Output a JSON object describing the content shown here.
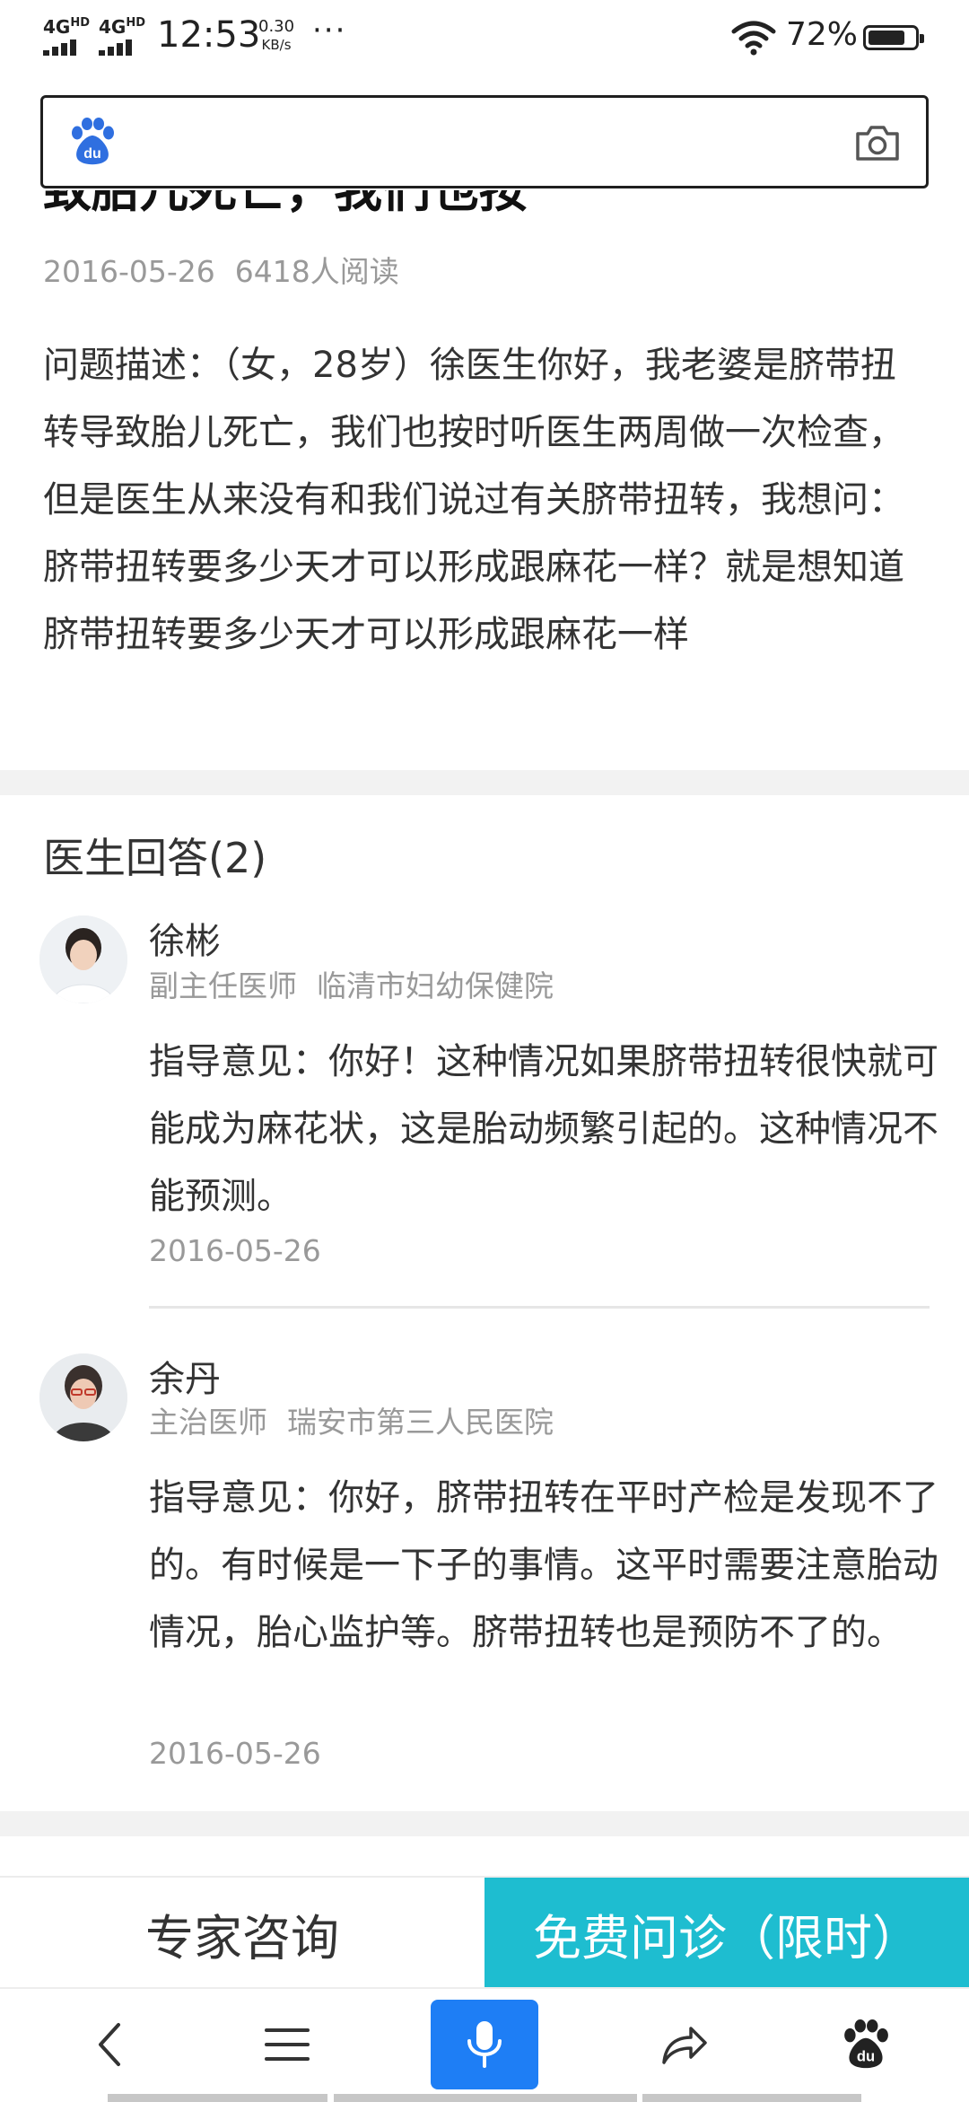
{
  "status_bar": {
    "network1": "4G",
    "network1_sup": "HD",
    "network2": "4G",
    "network2_sup": "HD",
    "time": "12:53",
    "speed_value": "0.30",
    "speed_unit": "KB/s",
    "more": "···",
    "battery_percent": "72%"
  },
  "search": {
    "logo_text": "du",
    "logo_icon": "baidu-paw-icon",
    "camera_icon": "camera-icon"
  },
  "article": {
    "title_partial": "致胎儿死亡，我们也按",
    "date": "2016-05-26",
    "reads": "6418人阅读",
    "question": "问题描述：（女，28岁）徐医生你好，我老婆是脐带扭转导致胎儿死亡，我们也按时听医生两周做一次检查，但是医生从来没有和我们说过有关脐带扭转，我想问：脐带扭转要多少天才可以形成跟麻花一样？就是想知道脐带扭转要多少天才可以形成跟麻花一样"
  },
  "answers_section": {
    "title": "医生回答(2)"
  },
  "answers": [
    {
      "name": "徐彬",
      "title": "副主任医师",
      "hospital": "临清市妇幼保健院",
      "text": "指导意见：你好！这种情况如果脐带扭转很快就可能成为麻花状，这是胎动频繁引起的。这种情况不能预测。",
      "date": "2016-05-26"
    },
    {
      "name": "余丹",
      "title": "主治医师",
      "hospital": "瑞安市第三人民医院",
      "text": "指导意见：你好，脐带扭转在平时产检是发现不了的。有时候是一下子的事情。这平时需要注意胎动情况，胎心监护等。脐带扭转也是预防不了的。",
      "date": "2016-05-26"
    }
  ],
  "cta": {
    "expert": "专家咨询",
    "free": "免费问诊（限时）"
  },
  "nav": {
    "back_icon": "chevron-left-icon",
    "menu_icon": "menu-icon",
    "mic_icon": "microphone-icon",
    "share_icon": "share-icon",
    "home_icon": "baidu-paw-icon",
    "home_text": "du"
  },
  "colors": {
    "accent_teal": "#1ebdd0",
    "mic_blue": "#1e7ef5",
    "baidu_blue": "#2f6fe0"
  }
}
